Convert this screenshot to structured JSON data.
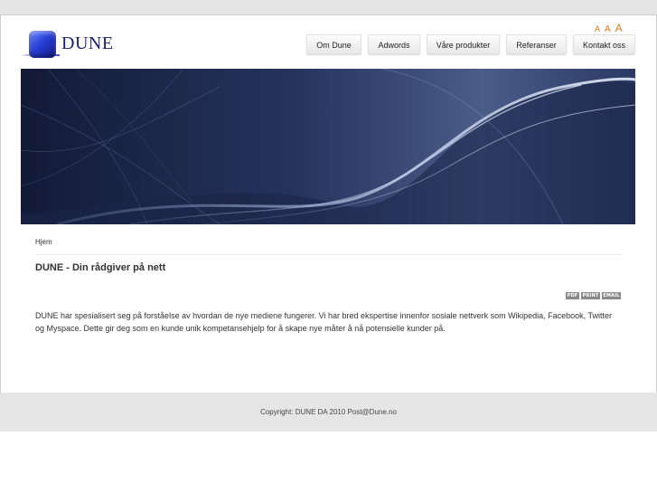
{
  "logo": {
    "text": "DUNE"
  },
  "font_sizer": [
    "A",
    "A",
    "A"
  ],
  "nav": {
    "items": [
      {
        "label": "Om Dune"
      },
      {
        "label": "Adwords"
      },
      {
        "label": "Våre produkter"
      },
      {
        "label": "Referanser"
      },
      {
        "label": "Kontakt oss"
      }
    ]
  },
  "breadcrumb": "Hjem",
  "article": {
    "title": "DUNE - Din rådgiver på nett",
    "icons": [
      "PDF",
      "PRINT",
      "EMAIL"
    ],
    "body": "DUNE har spesialisert seg på forståelse av hvordan de nye mediene fungerer. Vi har bred ekspertise innenfor sosiale nettverk som Wikipedia, Facebook, Twitter og Myspace. Dette gir deg som en kunde unik kompetansehjelp for å skape nye måter å nå potensielle kunder på."
  },
  "footer": {
    "text": "Copyright: DUNE DA 2010 Post@Dune.no"
  },
  "colors": {
    "accent": "#e07a1c",
    "banner": "#22305a",
    "logo": "#1a1f6e"
  }
}
